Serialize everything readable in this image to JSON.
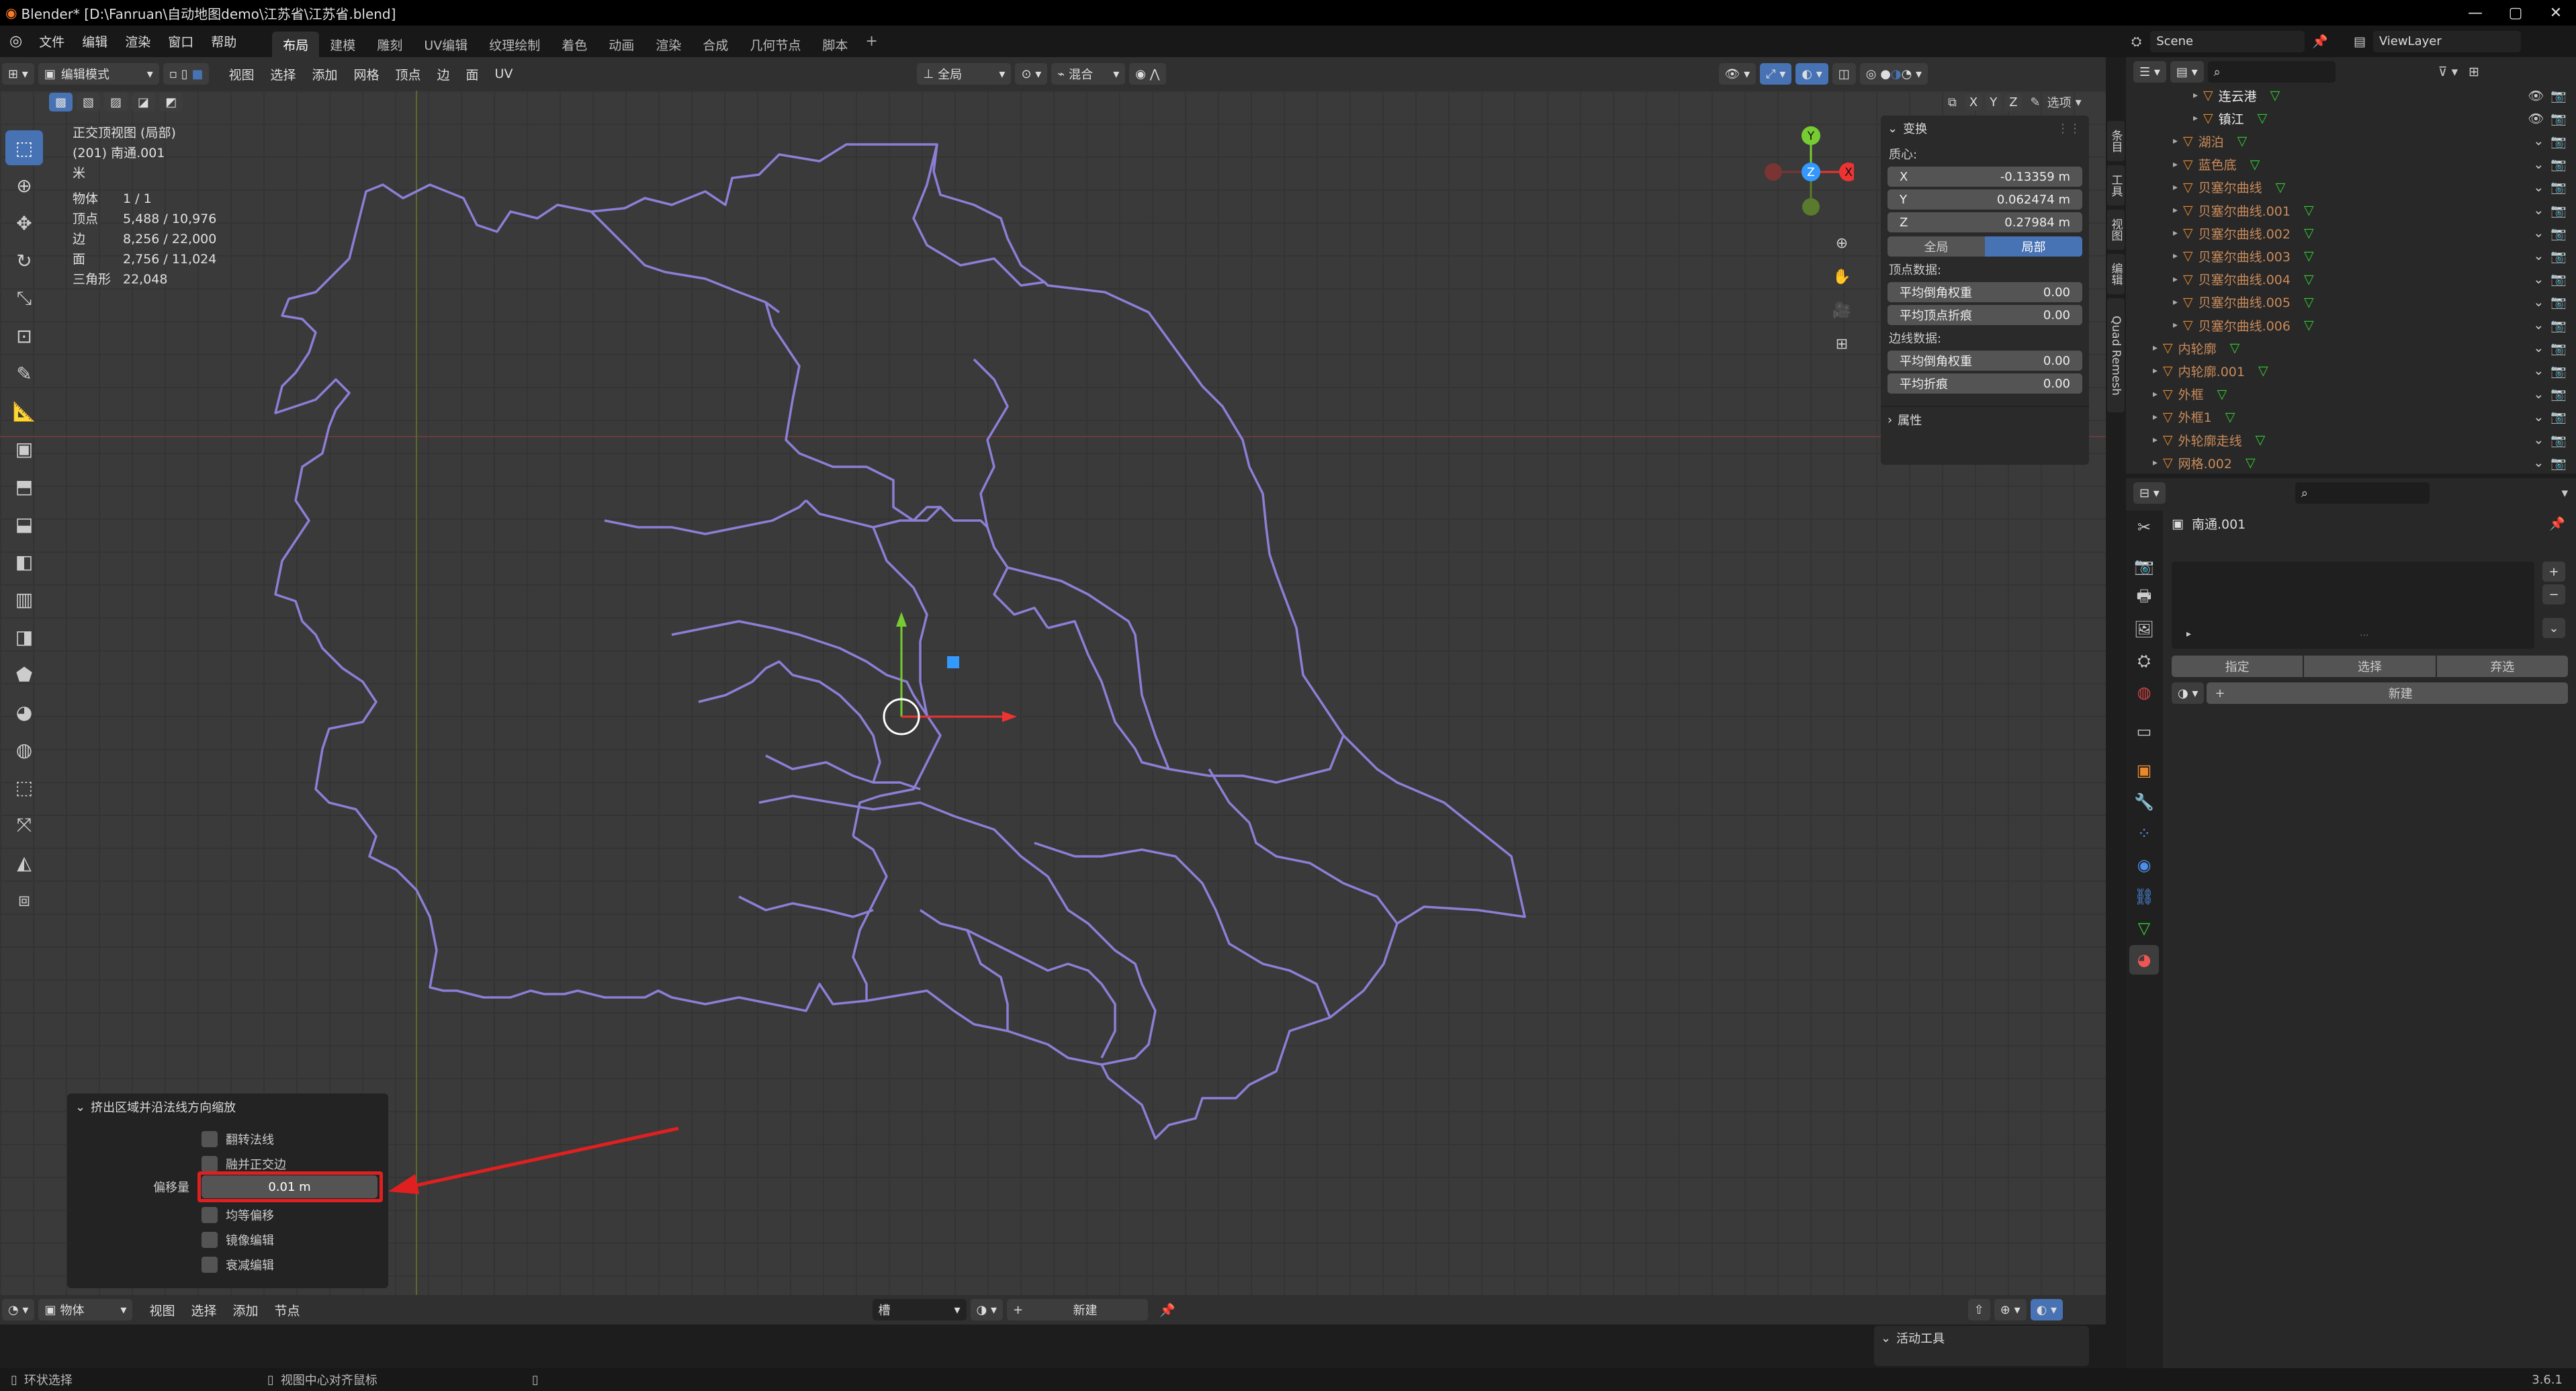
{
  "window": {
    "title": "Blender* [D:\\Fanruan\\自动地图demo\\江苏省\\江苏省.blend]"
  },
  "topbar": {
    "menus": [
      "文件",
      "编辑",
      "渲染",
      "窗口",
      "帮助"
    ],
    "workspaces": [
      "布局",
      "建模",
      "雕刻",
      "UV编辑",
      "纹理绘制",
      "着色",
      "动画",
      "渲染",
      "合成",
      "几何节点",
      "脚本"
    ],
    "scene": "Scene",
    "view_layer": "ViewLayer"
  },
  "viewport_header": {
    "mode": "编辑模式",
    "menus": [
      "视图",
      "选择",
      "添加",
      "网格",
      "顶点",
      "边",
      "面",
      "UV"
    ],
    "transform_orientation": "全局",
    "snap_mode": "混合",
    "options": "选项",
    "axes": [
      "X",
      "Y",
      "Z"
    ]
  },
  "overlay": {
    "view_name": "正交顶视图 (局部)",
    "object_name": "(201) 南通.001",
    "unit": "米",
    "stats": [
      {
        "label": "物体",
        "value": "1 / 1"
      },
      {
        "label": "顶点",
        "value": "5,488 / 10,976"
      },
      {
        "label": "边",
        "value": "8,256 / 22,000"
      },
      {
        "label": "面",
        "value": "2,756 / 11,024"
      },
      {
        "label": "三角形",
        "value": "22,048"
      }
    ]
  },
  "npanel": {
    "transform_title": "变换",
    "median_label": "质心:",
    "x_label": "X",
    "x_value": "-0.13359 m",
    "y_label": "Y",
    "y_value": "0.062474 m",
    "z_label": "Z",
    "z_value": "0.27984 m",
    "global": "全局",
    "local": "局部",
    "vertex_data": "顶点数据:",
    "vert_bevel": "平均倒角权重",
    "vert_bevel_value": "0.00",
    "vert_crease": "平均顶点折痕",
    "vert_crease_value": "0.00",
    "edge_data": "边线数据:",
    "edge_bevel": "平均倒角权重",
    "edge_bevel_value": "0.00",
    "edge_crease": "平均折痕",
    "edge_crease_value": "0.00",
    "attributes": "属性"
  },
  "side_tabs": [
    "条目",
    "工具",
    "视图",
    "编辑",
    "Quad Remesh"
  ],
  "operator_panel": {
    "title": "挤出区域并沿法线方向缩放",
    "flip_normals": "翻转法线",
    "dissolve": "融并正交边",
    "offset_label": "偏移量",
    "offset_value": "0.01 m",
    "even_offset": "均等偏移",
    "mirror": "镜像编辑",
    "proportional": "衰减编辑"
  },
  "bottom_header": {
    "mode": "物体",
    "menus": [
      "视图",
      "选择",
      "添加",
      "节点"
    ],
    "slot": "槽",
    "new_label": "新建"
  },
  "active_tool": "活动工具",
  "statusbar": {
    "left": "环状选择",
    "middle": "视图中心对齐鼠标",
    "version": "3.6.1"
  },
  "outliner": {
    "items": [
      "连云港",
      "镇江",
      "湖泊",
      "蓝色底",
      "贝塞尔曲线",
      "贝塞尔曲线.001",
      "贝塞尔曲线.002",
      "贝塞尔曲线.003",
      "贝塞尔曲线.004",
      "贝塞尔曲线.005",
      "贝塞尔曲线.006",
      "内轮廓",
      "内轮廓.001",
      "外框",
      "外框1",
      "外轮廓走线",
      "网格.002"
    ]
  },
  "properties": {
    "object_name": "南通.001",
    "assign": "指定",
    "select": "选择",
    "deselect": "弃选",
    "new_label": "新建"
  },
  "colors": {
    "accent": "#4772b3",
    "outline": "#8b7fd6",
    "axis_x": "#e33",
    "axis_y": "#7c3",
    "axis_z": "#39f"
  }
}
